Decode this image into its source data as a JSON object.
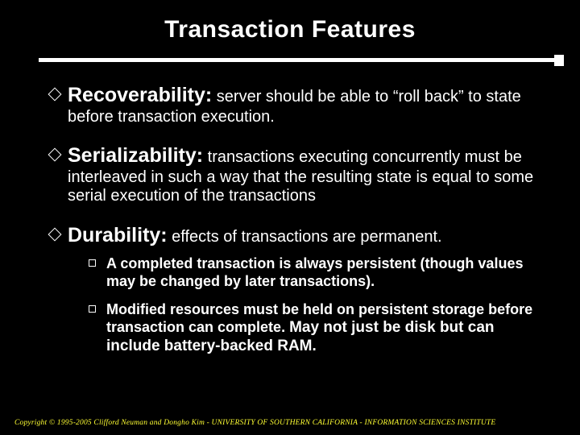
{
  "title": "Transaction Features",
  "items": [
    {
      "term": "Recoverability:",
      "desc": " server should be able to “roll back” to state before transaction execution."
    },
    {
      "term": "Serializability:",
      "desc": " transactions executing concurrently must be interleaved in such a way that the resulting state is equal to some serial execution of the transactions"
    },
    {
      "term": "Durability:",
      "desc": " effects of transactions are permanent.",
      "subs": [
        {
          "text": "A completed transaction is always persistent (though values may be changed by later transactions)."
        },
        {
          "prefix": "Modified resources must be held on persistent storage before transaction can complete. ",
          "emph": "May not just be disk but can include battery-backed RAM."
        }
      ]
    }
  ],
  "footer": "Copyright © 1995-2005 Clifford Neuman and Dongho Kim - UNIVERSITY OF SOUTHERN CALIFORNIA - INFORMATION SCIENCES INSTITUTE"
}
